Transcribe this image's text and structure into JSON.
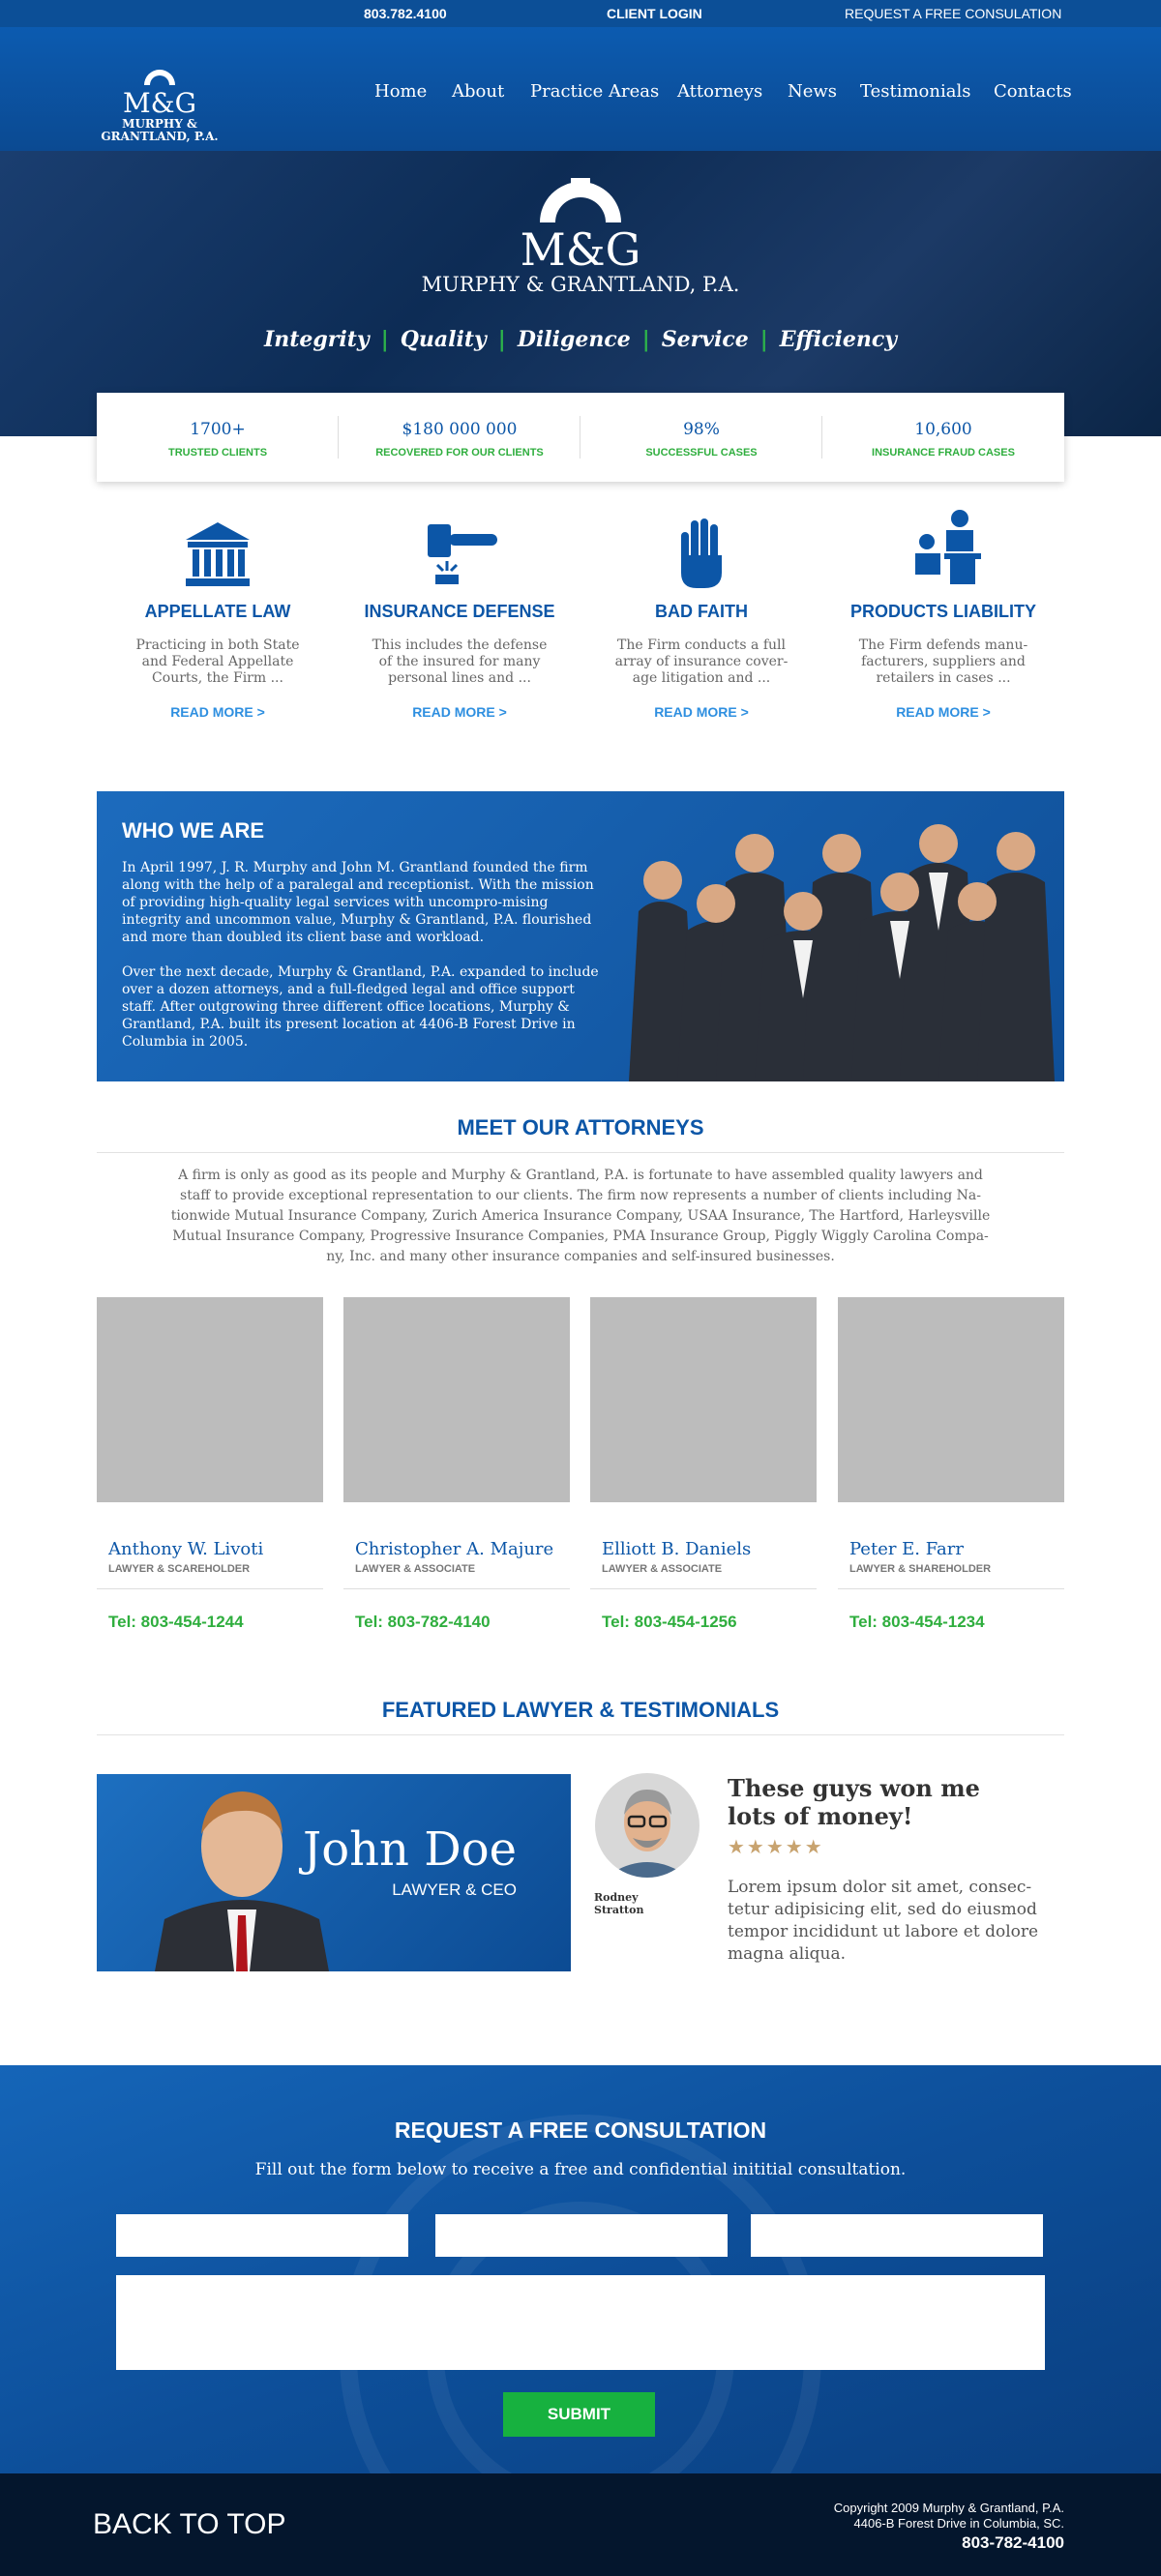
{
  "topbar": {
    "phone": "803.782.4100",
    "client_login": "CLIENT LOGIN",
    "request": "REQUEST A FREE CONSULATION"
  },
  "logo": {
    "initials": "M&G",
    "name_line1": "MURPHY &",
    "name_line2": "GRANTLAND, P.A."
  },
  "nav": [
    "Home",
    "About",
    "Practice Areas",
    "Attorneys",
    "News",
    "Testimonials",
    "Contacts"
  ],
  "hero": {
    "initials": "M&G",
    "firm_name": "MURPHY & GRANTLAND, P.A.",
    "values": [
      "Integrity",
      "Quality",
      "Diligence",
      "Service",
      "Efficiency"
    ]
  },
  "stats": [
    {
      "number": "1700+",
      "label": "TRUSTED CLIENTS"
    },
    {
      "number": "$180 000 000",
      "label": "RECOVERED FOR OUR CLIENTS"
    },
    {
      "number": "98%",
      "label": "SUCCESSFUL CASES"
    },
    {
      "number": "10,600",
      "label": "INSURANCE FRAUD CASES"
    }
  ],
  "practice_areas": [
    {
      "icon": "courthouse-icon",
      "title": "APPELLATE LAW",
      "desc": "Practicing in both State and Federal Appellate Courts, the Firm ...",
      "more": "READ MORE >"
    },
    {
      "icon": "gavel-icon",
      "title": "INSURANCE DEFENSE",
      "desc": "This includes the defense of the insured for many personal lines and ...",
      "more": "READ MORE >"
    },
    {
      "icon": "hand-icon",
      "title": "BAD FAITH",
      "desc": "The Firm conducts a full array of insurance cover-age litigation and ...",
      "more": "READ MORE >"
    },
    {
      "icon": "meeting-icon",
      "title": "PRODUCTS LIABILITY",
      "desc": "The Firm defends manu-facturers, suppliers and retailers in cases ...",
      "more": "READ MORE >"
    }
  ],
  "who": {
    "title": "WHO WE ARE",
    "p1": "In April 1997, J. R. Murphy and John M. Grantland founded the firm along with the help of a paralegal and receptionist.  With the mission of providing high-quality legal services with uncompro-mising integrity and uncommon value, Murphy & Grantland, P.A. flourished and more than doubled its client base and workload.",
    "p2": "Over the next decade, Murphy & Grantland, P.A. expanded to include over a dozen attorneys, and a full-fledged legal and office support staff.  After outgrowing three different office locations, Murphy & Grantland, P.A. built its present location at 4406-B Forest Drive in Columbia in 2005."
  },
  "attorneys_section": {
    "title": "MEET OUR ATTORNEYS",
    "intro": "A firm is only as good as its people and Murphy & Grantland, P.A. is fortunate to have assembled quality lawyers and staff to provide exceptional representation to our clients.  The firm now represents a number of clients including Na-tionwide Mutual Insurance Company, Zurich America Insurance Company, USAA Insurance, The Hartford, Harleysville Mutual Insurance Company, Progressive Insurance Companies, PMA Insurance Group, Piggly Wiggly Carolina Compa-ny, Inc. and many other insurance companies and self-insured businesses."
  },
  "attorneys": [
    {
      "name": "Anthony W. Livoti",
      "role": "LAWYER & SCAREHOLDER",
      "tel": "Tel: 803-454-1244"
    },
    {
      "name": "Christopher A. Majure",
      "role": "LAWYER & ASSOCIATE",
      "tel": "Tel: 803-782-4140"
    },
    {
      "name": "Elliott B. Daniels",
      "role": "LAWYER & ASSOCIATE",
      "tel": "Tel: 803-454-1256"
    },
    {
      "name": "Peter E. Farr",
      "role": "LAWYER & SHAREHOLDER",
      "tel": "Tel: 803-454-1234"
    }
  ],
  "featured": {
    "title": "FEATURED LAWYER & TESTIMONIALS",
    "lawyer_name": "John Doe",
    "lawyer_role": "LAWYER & CEO",
    "quote": "These guys won me lots of money!",
    "stars": "★★★★★",
    "text": "Lorem ipsum dolor sit amet, consec-tetur adipisicing elit, sed do eiusmod tempor incididunt ut labore et dolore magna aliqua.",
    "reviewer": "Rodney Stratton"
  },
  "consult": {
    "title": "REQUEST A FREE CONSULTATION",
    "subtitle": "Fill out the form below to receive a free and confidential inititial consultation.",
    "submit": "SUBMIT"
  },
  "footer": {
    "back_to_top": "BACK TO TOP",
    "copyright": "Copyright 2009 Murphy & Grantland, P.A.",
    "address": "4406-B Forest Drive in Columbia, SC.",
    "phone": "803-782-4100"
  },
  "colors": {
    "brand_blue": "#0c56a7",
    "accent_green": "#2fae3e",
    "footer": "#04162d"
  }
}
